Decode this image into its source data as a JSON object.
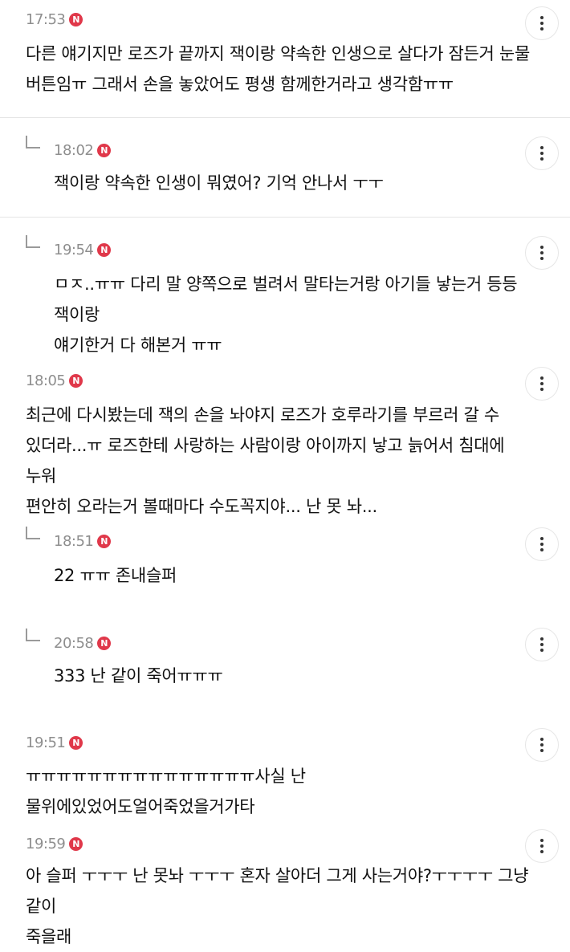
{
  "comments": [
    {
      "time": "17:53",
      "badge": "N",
      "text": "다른 얘기지만 로즈가 끝까지 잭이랑 약속한 인생으로 살다가 잠든거 눈물\n버튼임ㅠ 그래서 손을 놓았어도 평생 함께한거라고 생각함ㅠㅠ"
    },
    {
      "time": "18:02",
      "badge": "N",
      "text": "잭이랑 약속한 인생이 뭐였어? 기억 안나서 ㅜㅜ"
    },
    {
      "time": "19:54",
      "badge": "N",
      "text": "ㅁㅈ..ㅠㅠ 다리 말 양쪽으로 벌려서 말타는거랑 아기들 낳는거 등등 잭이랑\n얘기한거 다 해본거 ㅠㅠ"
    },
    {
      "time": "18:05",
      "badge": "N",
      "text": "최근에 다시봤는데 잭의 손을 놔야지 로즈가 호루라기를 부르러 갈 수\n있더라...ㅠ 로즈한테 사랑하는 사람이랑 아이까지 낳고 늙어서 침대에 누워\n편안히 오라는거 볼때마다 수도꼭지야... 난 못 놔..."
    },
    {
      "time": "18:51",
      "badge": "N",
      "text": "22 ㅠㅠ 존내슬퍼"
    },
    {
      "time": "20:58",
      "badge": "N",
      "text": "333 난 같이 죽어ㅠㅠㅠ"
    },
    {
      "time": "19:51",
      "badge": "N",
      "text": "ㅠㅠㅠㅠㅠㅠㅠㅠㅠㅠㅠㅠㅠㅠㅠ사실 난 물위에있었어도얼어죽었을거가타"
    },
    {
      "time": "19:59",
      "badge": "N",
      "text": "아 슬퍼 ㅜㅜㅜ 난 못놔 ㅜㅜㅜ 혼자 살아더 그게 사는거야?ㅜㅜㅜㅜ 그냥 같이\n죽을래"
    }
  ],
  "icons": {
    "more": "vertical-ellipsis-icon",
    "reply": "reply-arrow-icon",
    "new_badge": "new-badge-icon"
  },
  "colors": {
    "badge": "#e0384a",
    "time": "#8e8e8e",
    "divider": "#e5e5e5"
  }
}
